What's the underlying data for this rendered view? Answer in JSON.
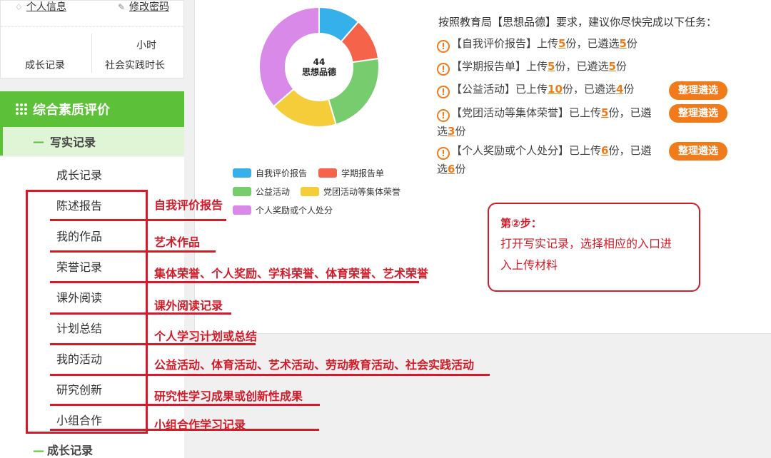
{
  "sidebar": {
    "personal_info": "个人信息",
    "change_password": "修改密码",
    "stat_unit": "小时",
    "stat_label_1": "成长记录",
    "stat_label_2": "社会实践时长",
    "section_title": "综合素质评价",
    "subsection_title": "写实记录",
    "items": [
      "成长记录",
      "陈述报告",
      "我的作品",
      "荣誉记录",
      "课外阅读",
      "计划总结",
      "我的活动",
      "研究创新",
      "小组合作"
    ],
    "bottom_item": "成长记录"
  },
  "chart_data": {
    "type": "pie",
    "center_value": "44",
    "center_label": "思想品德",
    "slices": [
      {
        "label": "自我评价报告",
        "value": 5,
        "color": "#36b0ea"
      },
      {
        "label": "学期报告单",
        "value": 5,
        "color": "#f5634a"
      },
      {
        "label": "公益活动",
        "value": 10,
        "color": "#77cc6d"
      },
      {
        "label": "党团活动等集体荣誉",
        "value": 8,
        "color": "#f5cd3b"
      },
      {
        "label": "个人奖励或个人处分",
        "value": 16,
        "color": "#d98ae8"
      }
    ]
  },
  "tasks": {
    "title": "按照教育局【思想品德】要求，建议你尽快完成以下任务：",
    "t1": {
      "pre": "【自我评价报告】上传",
      "n1": "5",
      "mid": "份，已遴选",
      "n2": "5",
      "post": "份"
    },
    "t2": {
      "pre": "【学期报告单】上传",
      "n1": "5",
      "mid": "份，已遴选",
      "n2": "5",
      "post": "份"
    },
    "t3": {
      "pre": "【公益活动】已上传",
      "n1": "10",
      "mid": "份，已遴选",
      "n2": "4",
      "post": "份"
    },
    "t4": {
      "pre": "【党团活动等集体荣誉】已上传",
      "n1": "5",
      "mid": "份，已遴",
      "line2_pre": "选",
      "n2": "3",
      "post": "份"
    },
    "t5": {
      "pre": "【个人奖励或个人处分】已上传",
      "n1": "6",
      "mid": "份，已遴",
      "line2_pre": "选",
      "n2": "6",
      "post": "份"
    },
    "button_label": "整理遴选"
  },
  "step_box": {
    "title": "第②步：",
    "text_line1": "打开写实记录，选择相应的入口进",
    "text_line2": "入上传材料"
  },
  "annotations": [
    "自我评价报告",
    "艺术作品",
    "集体荣誉、个人奖励、学科荣誉、体育荣誉、艺术荣誉",
    "课外阅读记录",
    "个人学习计划或总结",
    "公益活动、体育活动、艺术活动、劳动教育活动、社会实践活动",
    "研究性学习成果或创新性成果",
    "小组合作学习记录"
  ],
  "colors": {
    "green": "#5cc038",
    "orange": "#f07b1a",
    "red": "#d21c2a"
  }
}
